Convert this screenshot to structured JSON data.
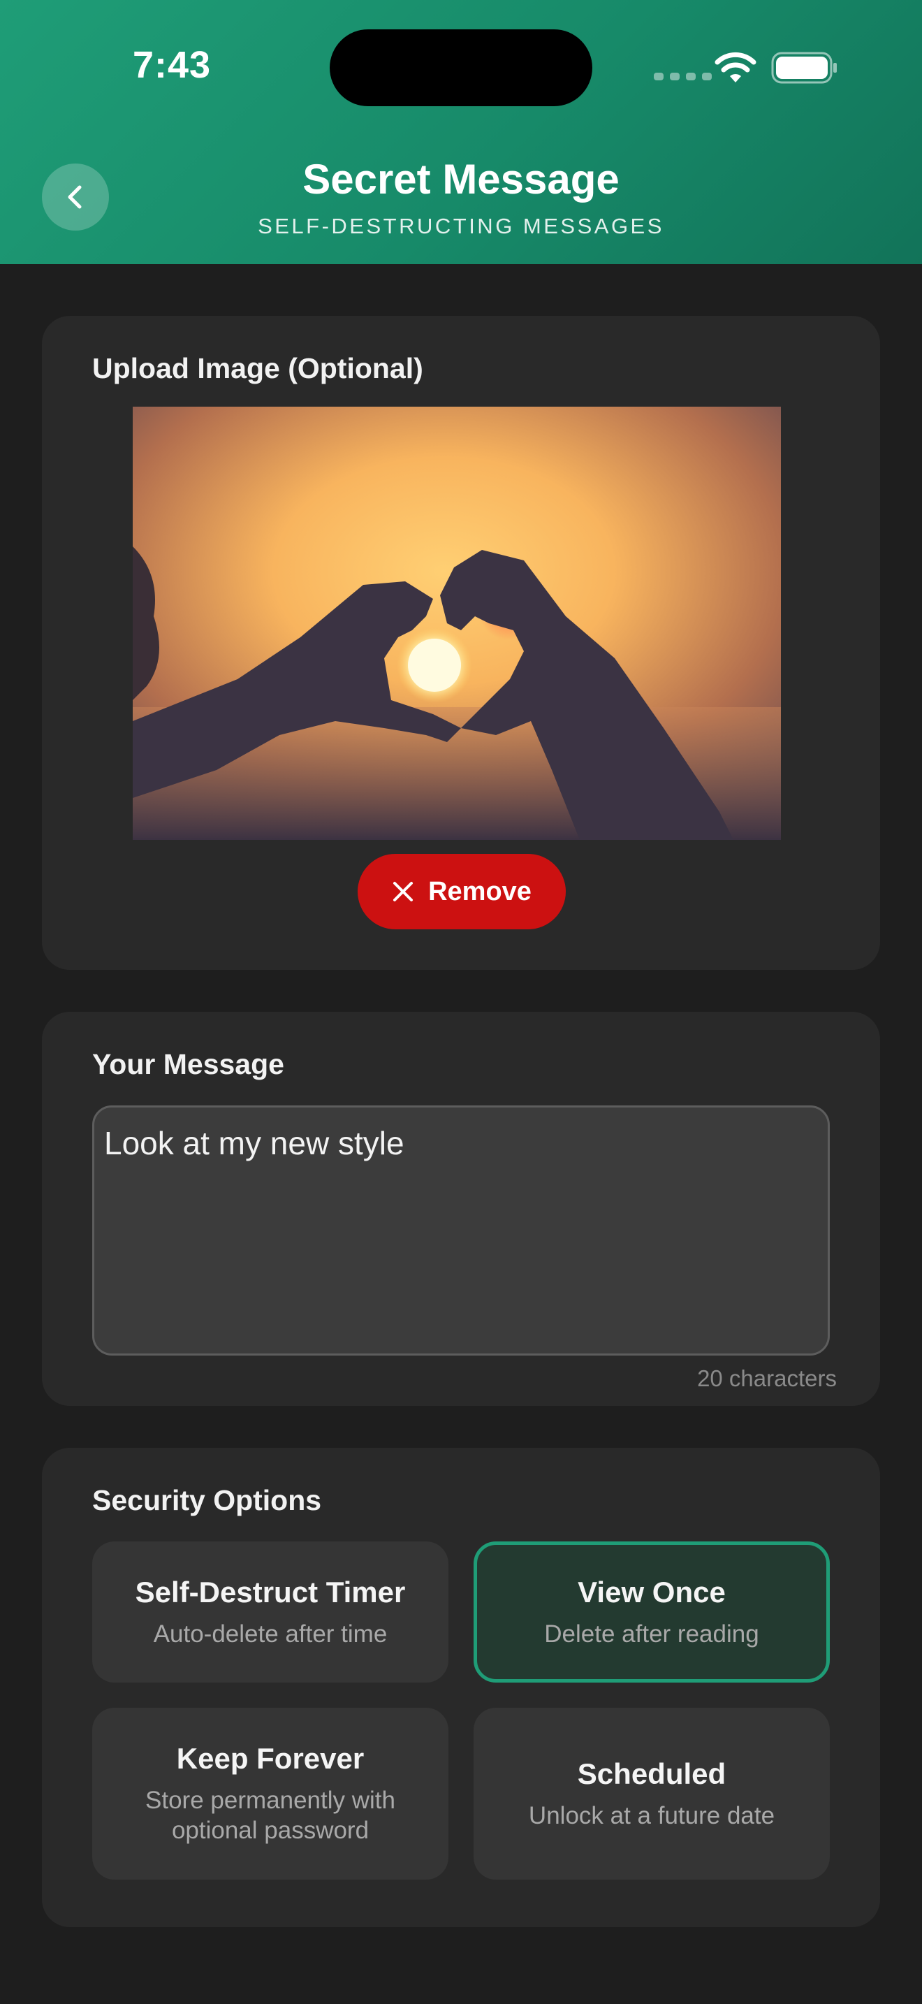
{
  "status_bar": {
    "time": "7:43"
  },
  "header": {
    "title": "Secret Message",
    "subtitle": "SELF-DESTRUCTING MESSAGES",
    "back_icon": "chevron-left-icon",
    "gradient_colors": [
      "#1f9d77",
      "#127359"
    ]
  },
  "upload": {
    "title": "Upload Image (Optional)",
    "image_description": "heart-hands-sunset-photo",
    "remove_label": "Remove",
    "remove_color": "#cc1111"
  },
  "message": {
    "title": "Your Message",
    "value": "Look at my new style",
    "char_count": "20 characters"
  },
  "security": {
    "title": "Security Options",
    "accent_color": "#1f9d77",
    "options": [
      {
        "title": "Self-Destruct Timer",
        "desc": "Auto-delete after time",
        "selected": false
      },
      {
        "title": "View Once",
        "desc": "Delete after reading",
        "selected": true
      },
      {
        "title": "Keep Forever",
        "desc": "Store permanently with optional password",
        "selected": false
      },
      {
        "title": "Scheduled",
        "desc": "Unlock at a future date",
        "selected": false
      }
    ]
  }
}
